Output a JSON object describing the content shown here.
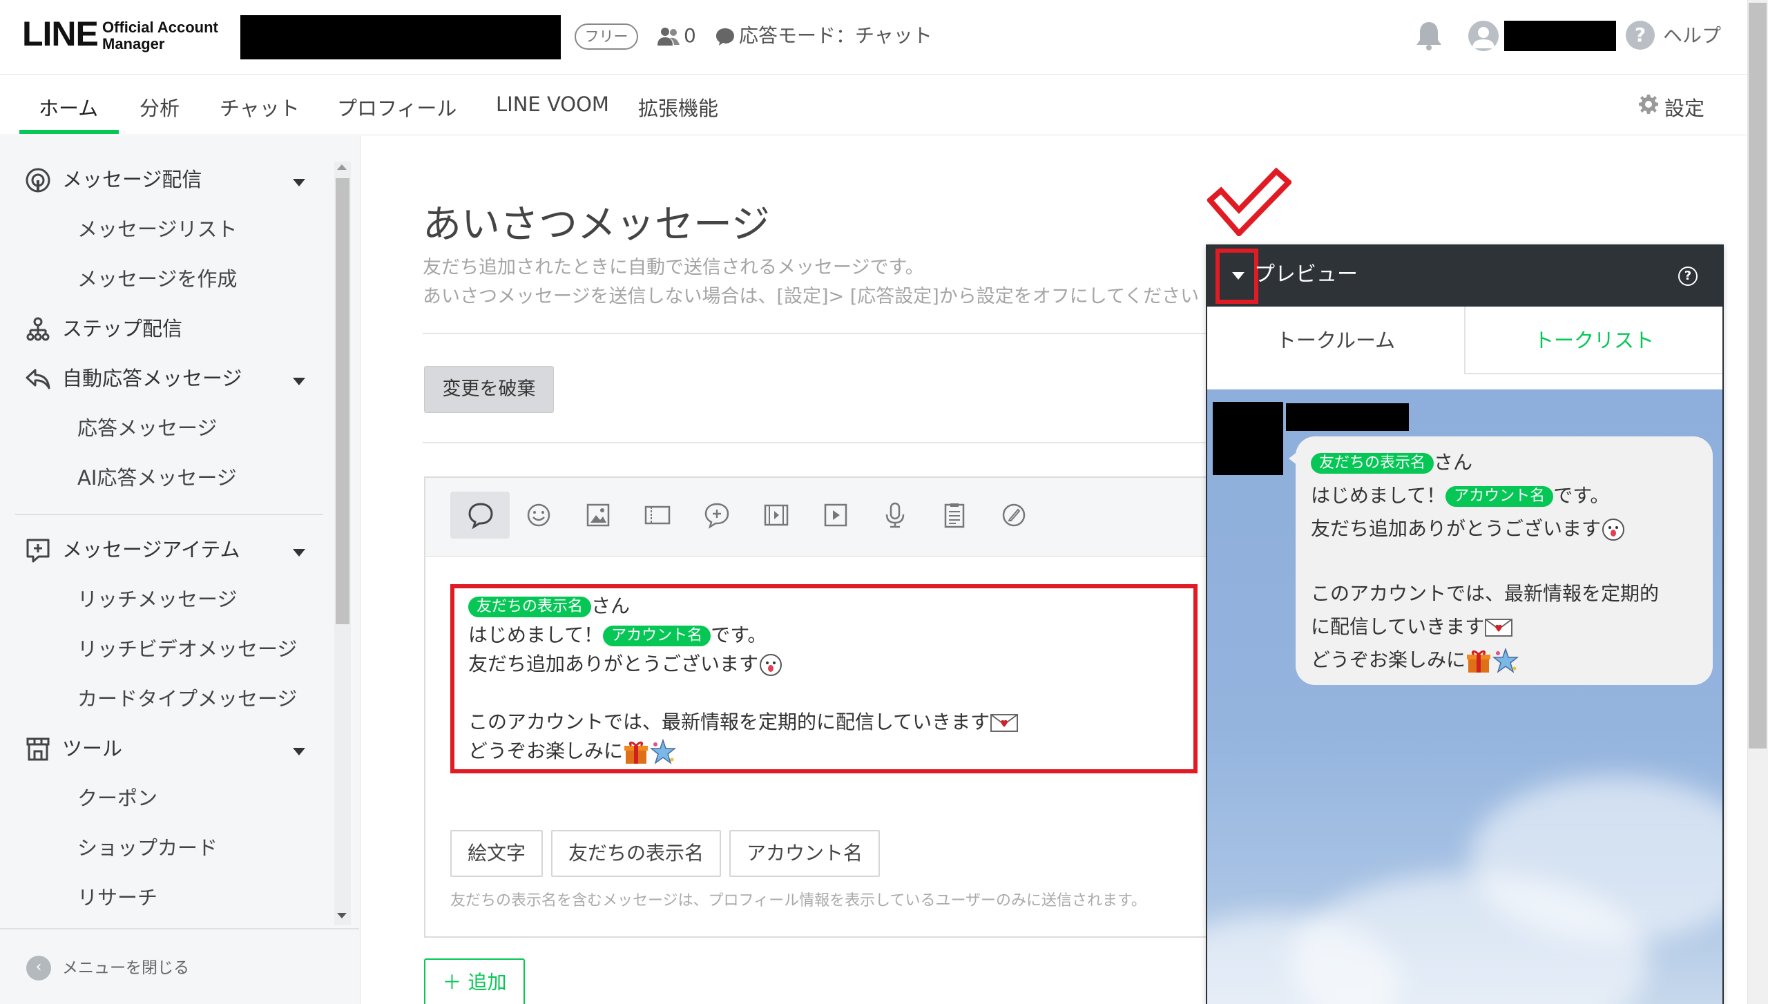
{
  "app": {
    "logo_line": "LINE",
    "logo_sub_1": "Official Account",
    "logo_sub_2": "Manager"
  },
  "header": {
    "plan_badge": "フリー",
    "friends_count": "0",
    "response_mode": "応答モード：チャット",
    "help_label": "ヘルプ"
  },
  "nav": {
    "items": [
      "ホーム",
      "分析",
      "チャット",
      "プロフィール",
      "LINE VOOM",
      "拡張機能"
    ],
    "settings_label": "設定"
  },
  "sidebar": {
    "groups": [
      {
        "label": "メッセージ配信",
        "icon": "broadcast-icon",
        "sub": [
          "メッセージリスト",
          "メッセージを作成"
        ]
      },
      {
        "label": "ステップ配信",
        "icon": "step-flow-icon",
        "sub": []
      },
      {
        "label": "自動応答メッセージ",
        "icon": "reply-icon",
        "sub": [
          "応答メッセージ",
          "AI応答メッセージ"
        ]
      },
      {
        "label": "メッセージアイテム",
        "icon": "add-item-icon",
        "sub": [
          "リッチメッセージ",
          "リッチビデオメッセージ",
          "カードタイプメッセージ"
        ]
      },
      {
        "label": "ツール",
        "icon": "shop-icon",
        "sub": [
          "クーポン",
          "ショップカード",
          "リサーチ"
        ]
      }
    ],
    "close_menu_label": "メニューを閉じる"
  },
  "main": {
    "title": "あいさつメッセージ",
    "description_1": "友だち追加されたときに自動で送信されるメッセージです。",
    "description_2": "あいさつメッセージを送信しない場合は、[設定]> [応答設定]から設定をオフにしてください",
    "discard_button": "変更を破棄",
    "toolbar_icons": [
      "text-bubble-icon",
      "smiley-icon",
      "image-icon",
      "coupon-icon",
      "rich-message-icon",
      "rich-video-icon",
      "video-icon",
      "microphone-icon",
      "survey-icon",
      "card-icon"
    ],
    "message": {
      "tag_friend_name": "友だちの表示名",
      "tag_account_name": "アカウント名",
      "line1_suffix": "さん",
      "line2_prefix": "はじめまして！",
      "line2_suffix": "です。",
      "line3": "友だち追加ありがとうございます",
      "line4": "このアカウントでは、最新情報を定期的に配信していきます",
      "line5": "どうぞお楽しみに"
    },
    "insert_buttons": [
      "絵文字",
      "友だちの表示名",
      "アカウント名"
    ],
    "hint": "友だちの表示名を含むメッセージは、プロフィール情報を表示しているユーザーのみに送信されます。",
    "add_button": "追加"
  },
  "preview": {
    "title": "プレビュー",
    "help": "?",
    "tab_talkroom": "トークルーム",
    "tab_talklist": "トークリスト",
    "bubble": {
      "line3_a": "このアカウントでは、最新情報を定期的",
      "line3_b": "に配信していきます"
    }
  },
  "colors": {
    "brand_green": "#06c755",
    "annotation_red": "#e01b24",
    "preview_header": "#2e3338",
    "chat_bg": "#8eaedb"
  }
}
